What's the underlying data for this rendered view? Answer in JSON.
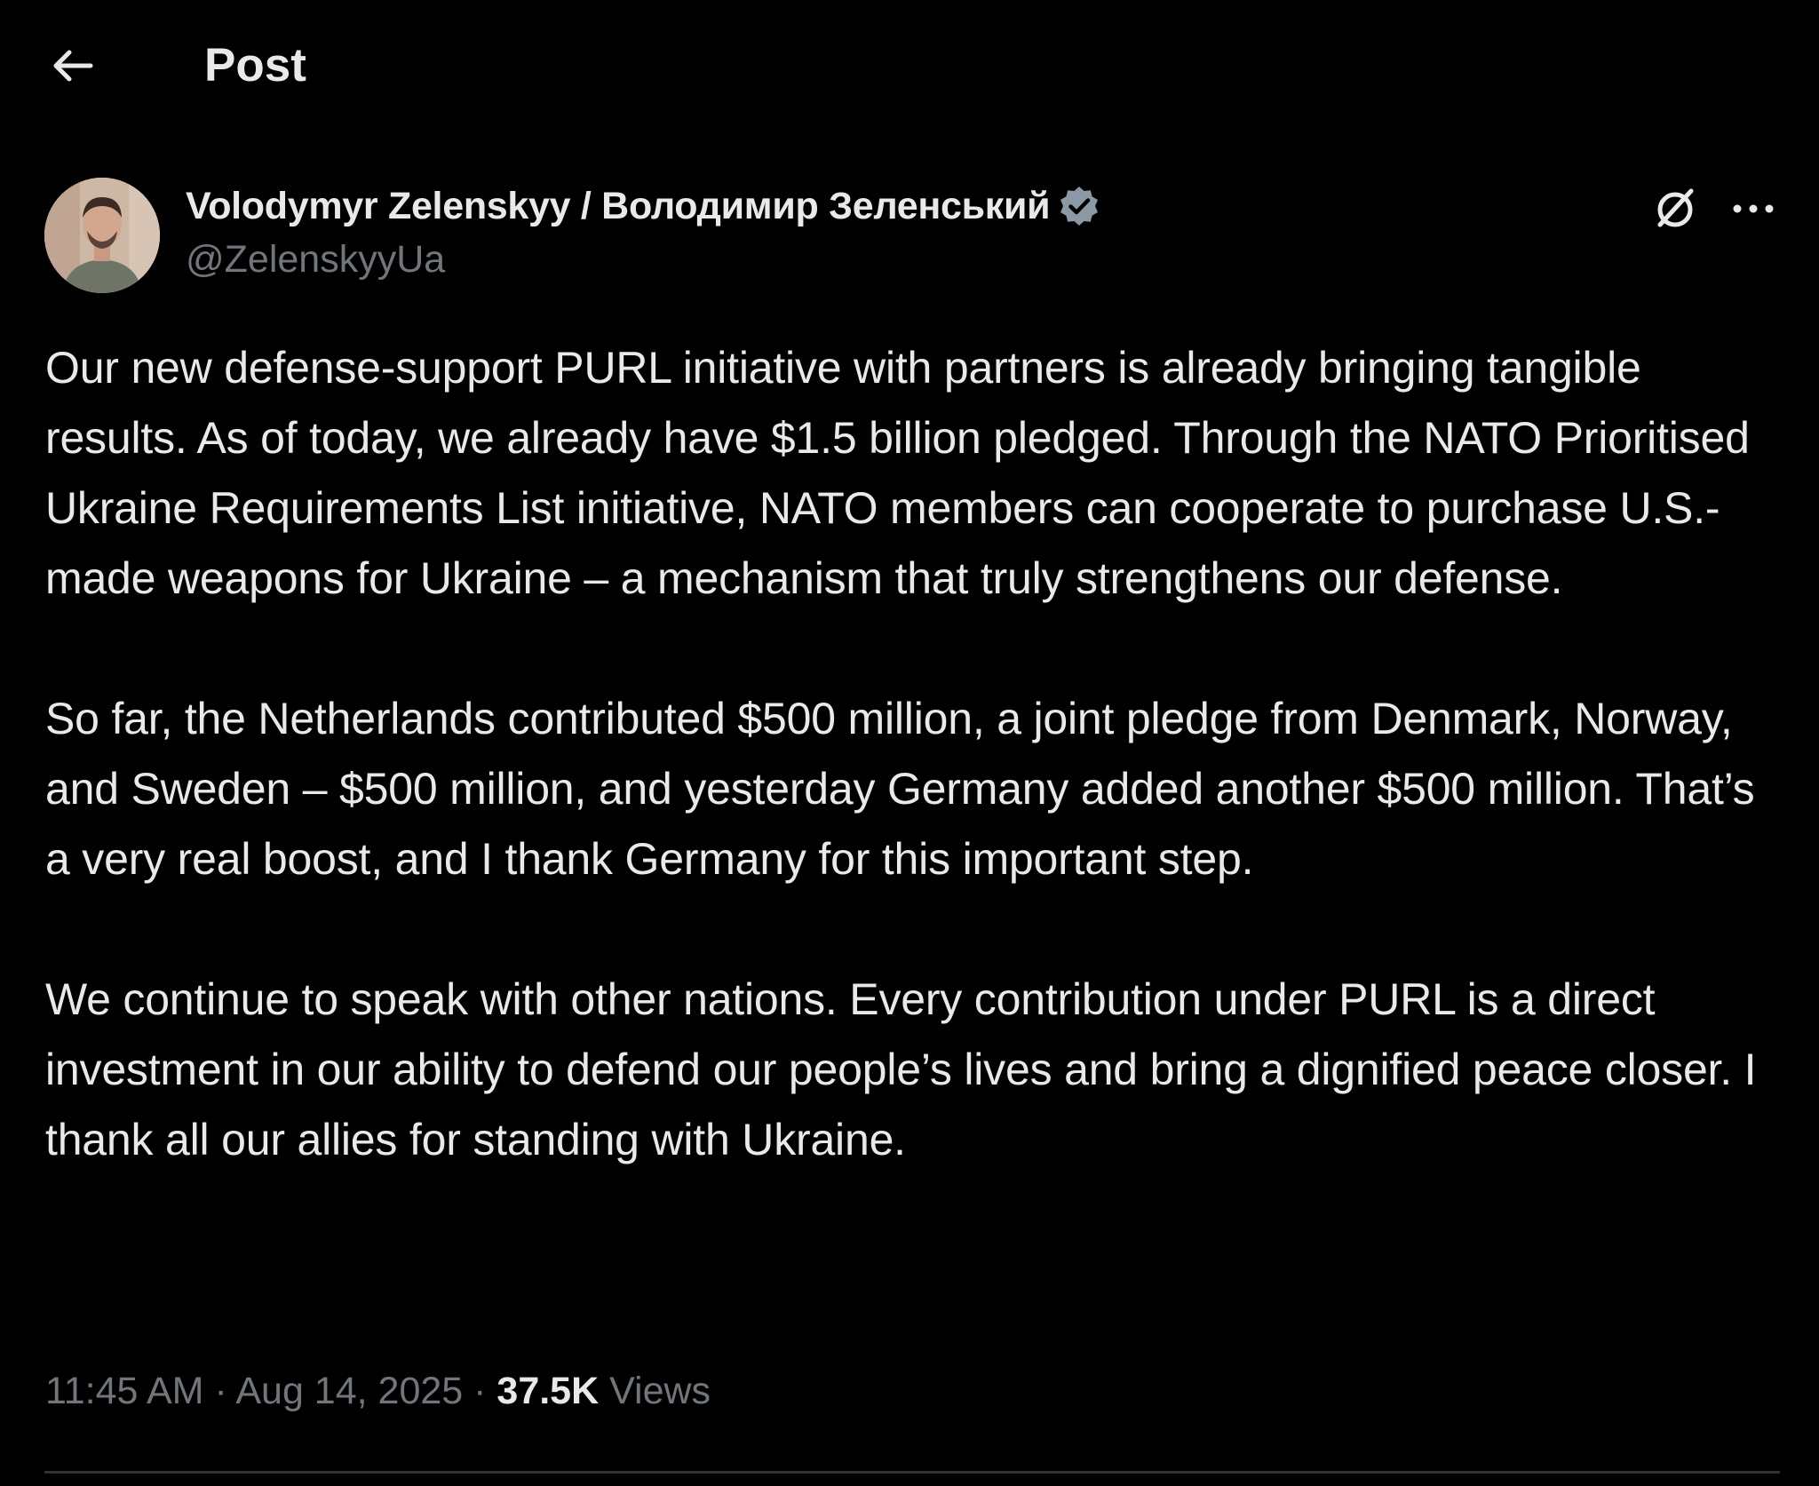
{
  "header": {
    "title": "Post",
    "back_icon": "arrow-left-icon"
  },
  "author": {
    "display_name": "Volodymyr Zelenskyy / Володимир Зеленський",
    "handle": "@ZelenskyyUa",
    "verified": true,
    "verified_color": "#8b98a5"
  },
  "actions": {
    "grok_icon": "grok-icon",
    "more_label": "···"
  },
  "post": {
    "paragraphs": [
      "Our new defense-support PURL initiative with partners is already bringing tangible results. As of today, we already have $1.5 billion pledged. Through the NATO Prioritised Ukraine Requirements List initiative, NATO members can cooperate to purchase U.S.-made weapons for Ukraine – a mechanism that truly strengthens our defense.",
      "So far, the Netherlands contributed $500 million, a joint pledge from Denmark, Norway, and Sweden – $500 million, and yesterday Germany added another $500 million. That’s a very real boost, and I thank Germany for this important step.",
      "We continue to speak with other nations. Every contribution under PURL is a direct investment in our ability to defend our people’s lives and bring a dignified peace closer. I thank all our allies for standing with Ukraine."
    ]
  },
  "meta": {
    "time": "11:45 AM",
    "separator": " · ",
    "date": "Aug 14, 2025",
    "views_count": "37.5K",
    "views_label": "Views"
  },
  "colors": {
    "background": "#000000",
    "text_primary": "#e7e9ea",
    "text_secondary": "#71767b",
    "divider": "#2f3336"
  }
}
